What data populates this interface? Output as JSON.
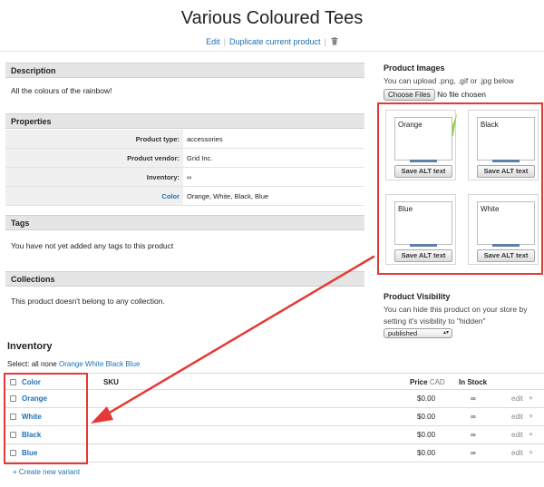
{
  "page": {
    "title": "Various Coloured Tees"
  },
  "header": {
    "edit_label": "Edit",
    "duplicate_label": "Duplicate current product",
    "trash_icon": "trash-icon"
  },
  "description": {
    "heading": "Description",
    "text": "All the colours of the rainbow!"
  },
  "properties": {
    "heading": "Properties",
    "rows": [
      {
        "key": "Product type:",
        "value": "accessories"
      },
      {
        "key": "Product vendor:",
        "value": "Grid Inc."
      },
      {
        "key": "Inventory:",
        "value": "∞"
      },
      {
        "key": "Color",
        "value": "Orange, White, Black, Blue"
      }
    ]
  },
  "tags": {
    "heading": "Tags",
    "text": "You have not yet added any tags to this product"
  },
  "collections": {
    "heading": "Collections",
    "text": "This product doesn't belong to any collection."
  },
  "images": {
    "heading": "Product Images",
    "help": "You can upload .png, .gif or .jpg below",
    "choose_files": "Choose Files",
    "no_file": "No file chosen",
    "cards": [
      {
        "alt": "Orange",
        "button": "Save ALT text"
      },
      {
        "alt": "Black",
        "button": "Save ALT text"
      },
      {
        "alt": "Blue",
        "button": "Save ALT text"
      },
      {
        "alt": "White",
        "button": "Save ALT text"
      }
    ]
  },
  "visibility": {
    "heading": "Product Visibility",
    "help_line1": "You can hide this product on your store by",
    "help_line2": "setting it's visibility to \"hidden\"",
    "selected": "published"
  },
  "inventory": {
    "heading": "Inventory",
    "select_prefix": "Select:",
    "select_all": "all",
    "select_none": "none",
    "select_options": [
      "Orange",
      "White",
      "Black",
      "Blue"
    ],
    "columns": {
      "color": "Color",
      "sku": "SKU",
      "price": "Price",
      "currency": "CAD",
      "stock": "In Stock"
    },
    "rows": [
      {
        "color": "Orange",
        "price": "$0.00",
        "stock": "∞",
        "edit": "edit",
        "plus": "+"
      },
      {
        "color": "White",
        "price": "$0.00",
        "stock": "∞",
        "edit": "edit",
        "plus": "+"
      },
      {
        "color": "Black",
        "price": "$0.00",
        "stock": "∞",
        "edit": "edit",
        "plus": "+"
      },
      {
        "color": "Blue",
        "price": "$0.00",
        "stock": "∞",
        "edit": "edit",
        "plus": "+"
      }
    ],
    "create_variant": "+ Create new variant"
  },
  "colors": {
    "link": "#1f6fb5",
    "highlight": "#e53935",
    "panel_header": "#e5e5e5"
  }
}
